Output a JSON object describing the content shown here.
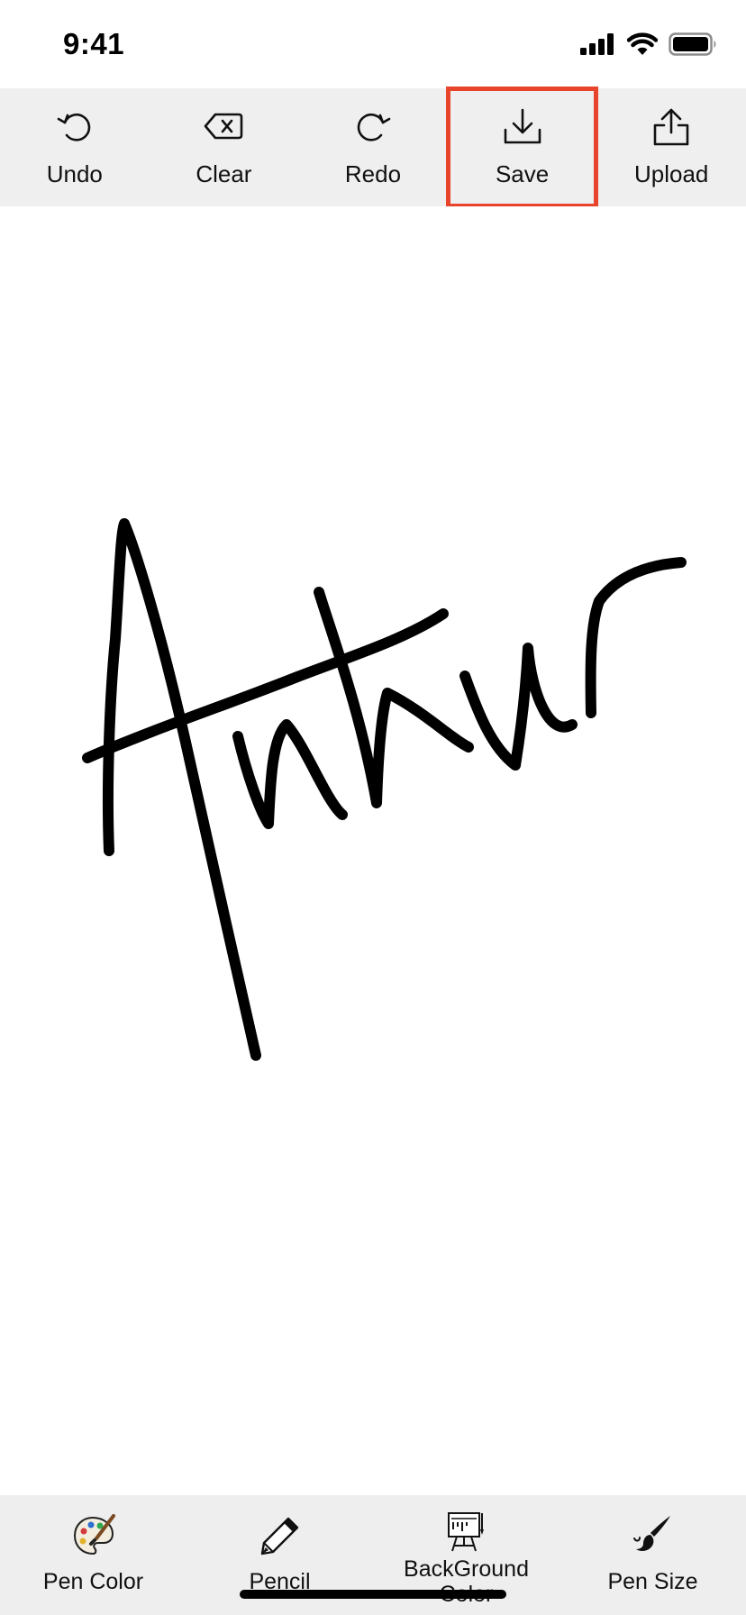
{
  "status_bar": {
    "time": "9:41",
    "icons": [
      "cellular-signal-icon",
      "wifi-icon",
      "battery-icon"
    ]
  },
  "toolbar": {
    "items": [
      {
        "label": "Undo",
        "icon": "undo-icon"
      },
      {
        "label": "Clear",
        "icon": "clear-icon"
      },
      {
        "label": "Redo",
        "icon": "redo-icon"
      },
      {
        "label": "Save",
        "icon": "save-download-icon",
        "highlighted": true
      },
      {
        "label": "Upload",
        "icon": "upload-icon"
      }
    ],
    "highlight_color": "#e8432b",
    "background_color": "#efefef"
  },
  "canvas": {
    "background_color": "#ffffff",
    "stroke_color": "#000000",
    "signature_text": "Ankur"
  },
  "bottom_toolbar": {
    "items": [
      {
        "label": "Pen Color",
        "icon": "palette-icon"
      },
      {
        "label": "Pencil",
        "icon": "pencil-icon"
      },
      {
        "label": "BackGround Color",
        "icon": "easel-icon"
      },
      {
        "label": "Pen Size",
        "icon": "brush-icon"
      }
    ],
    "background_color": "#eeeeee"
  }
}
